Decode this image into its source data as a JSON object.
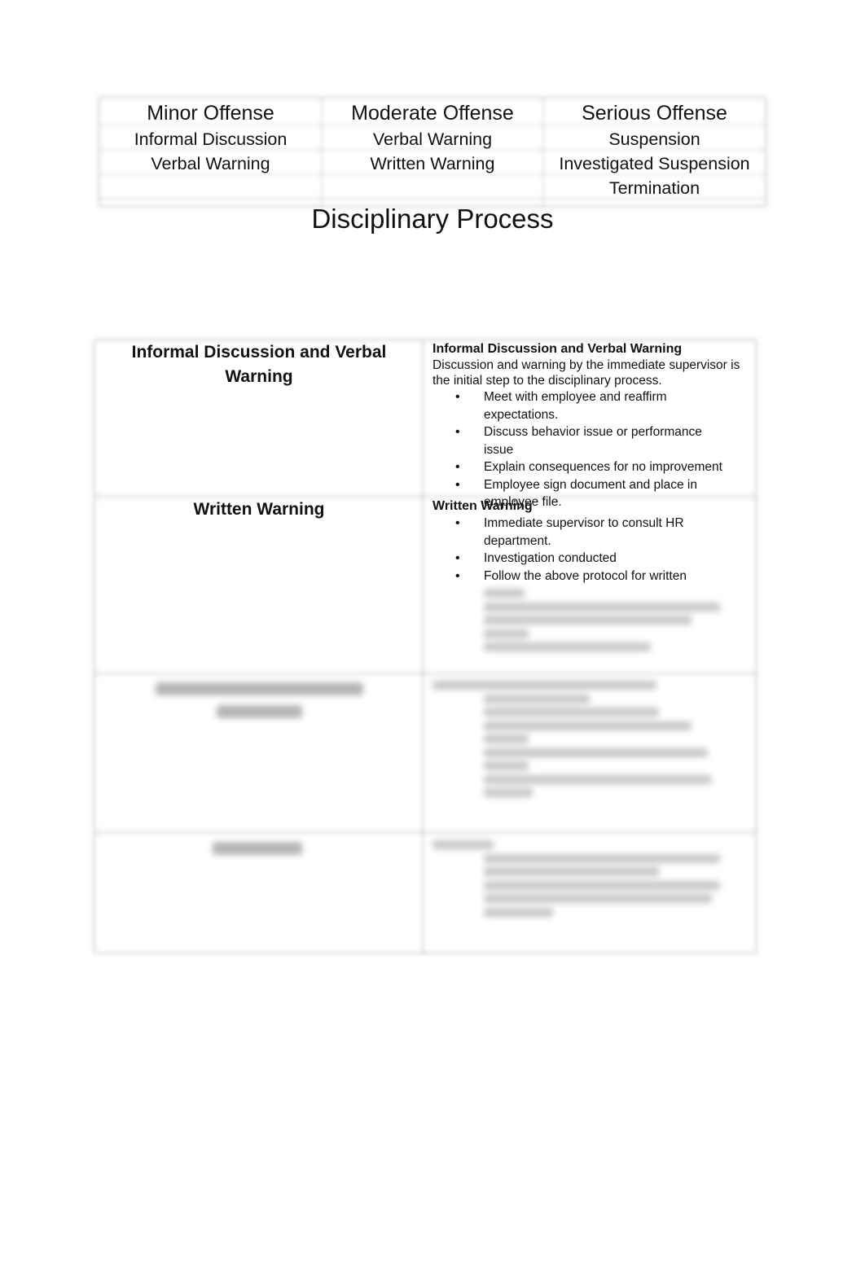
{
  "offense_table": {
    "columns": [
      {
        "heading": "Minor Offense",
        "items": [
          "Informal Discussion",
          "Verbal Warning"
        ]
      },
      {
        "heading": "Moderate Offense",
        "items": [
          "Verbal Warning",
          "Written Warning"
        ]
      },
      {
        "heading": "Serious Offense",
        "items": [
          "Suspension",
          "Investigated Suspension",
          "Termination"
        ]
      }
    ]
  },
  "title": "Disciplinary Process",
  "process_table": {
    "rows": [
      {
        "step": "Informal Discussion and Verbal Warning",
        "detail_heading": "Informal Discussion and Verbal Warning",
        "detail_description": "Discussion and warning by the immediate supervisor is the initial step to the disciplinary process.",
        "bullets": [
          "Meet with employee and reaffirm expectations.",
          "Discuss behavior issue or performance issue",
          "Explain consequences for no improvement",
          "Employee sign document and place in employee file."
        ]
      },
      {
        "step": "Written Warning",
        "detail_heading": "Written Warning",
        "bullets": [
          "Immediate supervisor to consult HR department.",
          "Investigation conducted",
          "Follow the above protocol for written"
        ],
        "blurred": true
      },
      {
        "step": "",
        "blurred": true
      },
      {
        "step": "",
        "blurred": true
      }
    ]
  }
}
